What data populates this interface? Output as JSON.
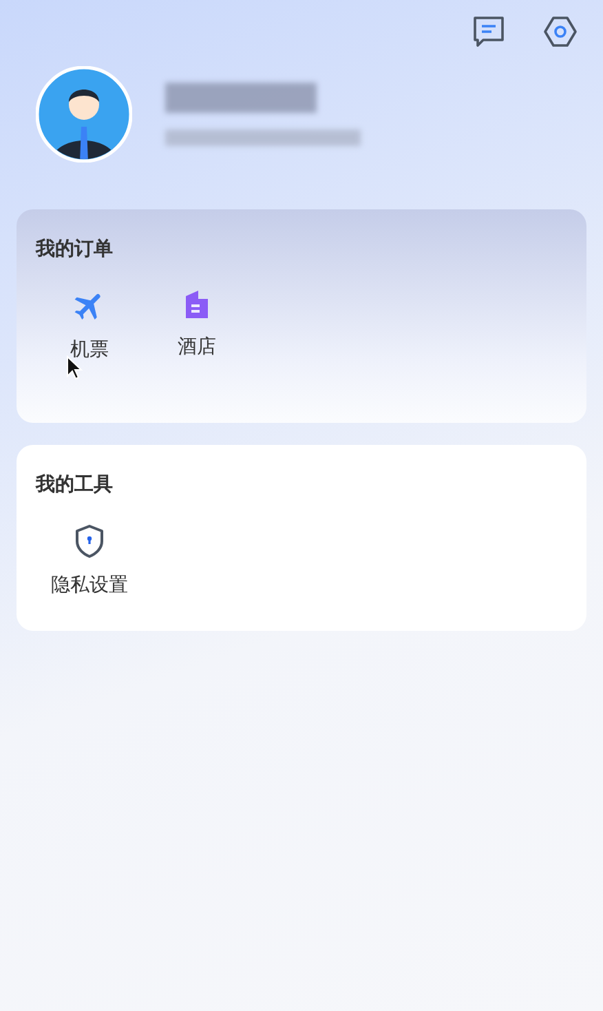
{
  "header": {
    "profile": {
      "name_redacted": true
    }
  },
  "sections": [
    {
      "title": "我的订单",
      "items": [
        {
          "kind": "plane",
          "label": "机票"
        },
        {
          "kind": "hotel",
          "label": "酒店"
        }
      ]
    },
    {
      "title": "我的工具",
      "items": [
        {
          "kind": "shield",
          "label": "隐私设置"
        }
      ]
    }
  ]
}
